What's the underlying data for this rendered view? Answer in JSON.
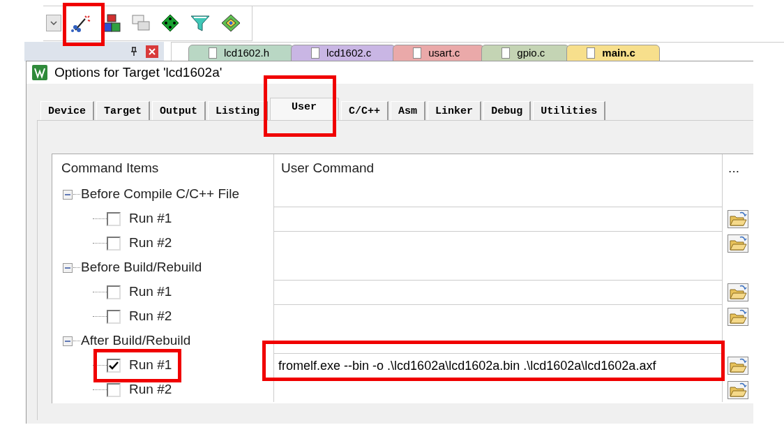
{
  "file_tabs": [
    {
      "label": "lcd1602.h",
      "color": "#b9d7c4",
      "selected": false
    },
    {
      "label": "lcd1602.c",
      "color": "#c9b6e4",
      "selected": false
    },
    {
      "label": "usart.c",
      "color": "#eaa9a9",
      "selected": false
    },
    {
      "label": "gpio.c",
      "color": "#c4d4b4",
      "selected": false
    },
    {
      "label": "main.c",
      "color": "#f7df8c",
      "selected": true
    }
  ],
  "dialog": {
    "title": "Options for Target 'lcd1602a'",
    "tabs": [
      {
        "label": "Device",
        "selected": false
      },
      {
        "label": "Target",
        "selected": false
      },
      {
        "label": "Output",
        "selected": false
      },
      {
        "label": "Listing",
        "selected": false
      },
      {
        "label": "User",
        "selected": true
      },
      {
        "label": "C/C++",
        "selected": false
      },
      {
        "label": "Asm",
        "selected": false
      },
      {
        "label": "Linker",
        "selected": false
      },
      {
        "label": "Debug",
        "selected": false
      },
      {
        "label": "Utilities",
        "selected": false
      }
    ],
    "table": {
      "columns": [
        "Command Items",
        "User Command",
        "..."
      ],
      "groups": [
        {
          "label": "Before Compile C/C++ File",
          "expanded": true,
          "children": [
            {
              "label": "Run #1",
              "checked": false
            },
            {
              "label": "Run #2",
              "checked": false
            }
          ]
        },
        {
          "label": "Before Build/Rebuild",
          "expanded": true,
          "children": [
            {
              "label": "Run #1",
              "checked": false
            },
            {
              "label": "Run #2",
              "checked": false
            }
          ]
        },
        {
          "label": "After Build/Rebuild",
          "expanded": true,
          "children": [
            {
              "label": "Run #1",
              "checked": true,
              "command": "fromelf.exe --bin -o .\\lcd1602a\\lcd1602a.bin .\\lcd1602a\\lcd1602a.axf"
            },
            {
              "label": "Run #2",
              "checked": false
            }
          ]
        }
      ]
    }
  }
}
